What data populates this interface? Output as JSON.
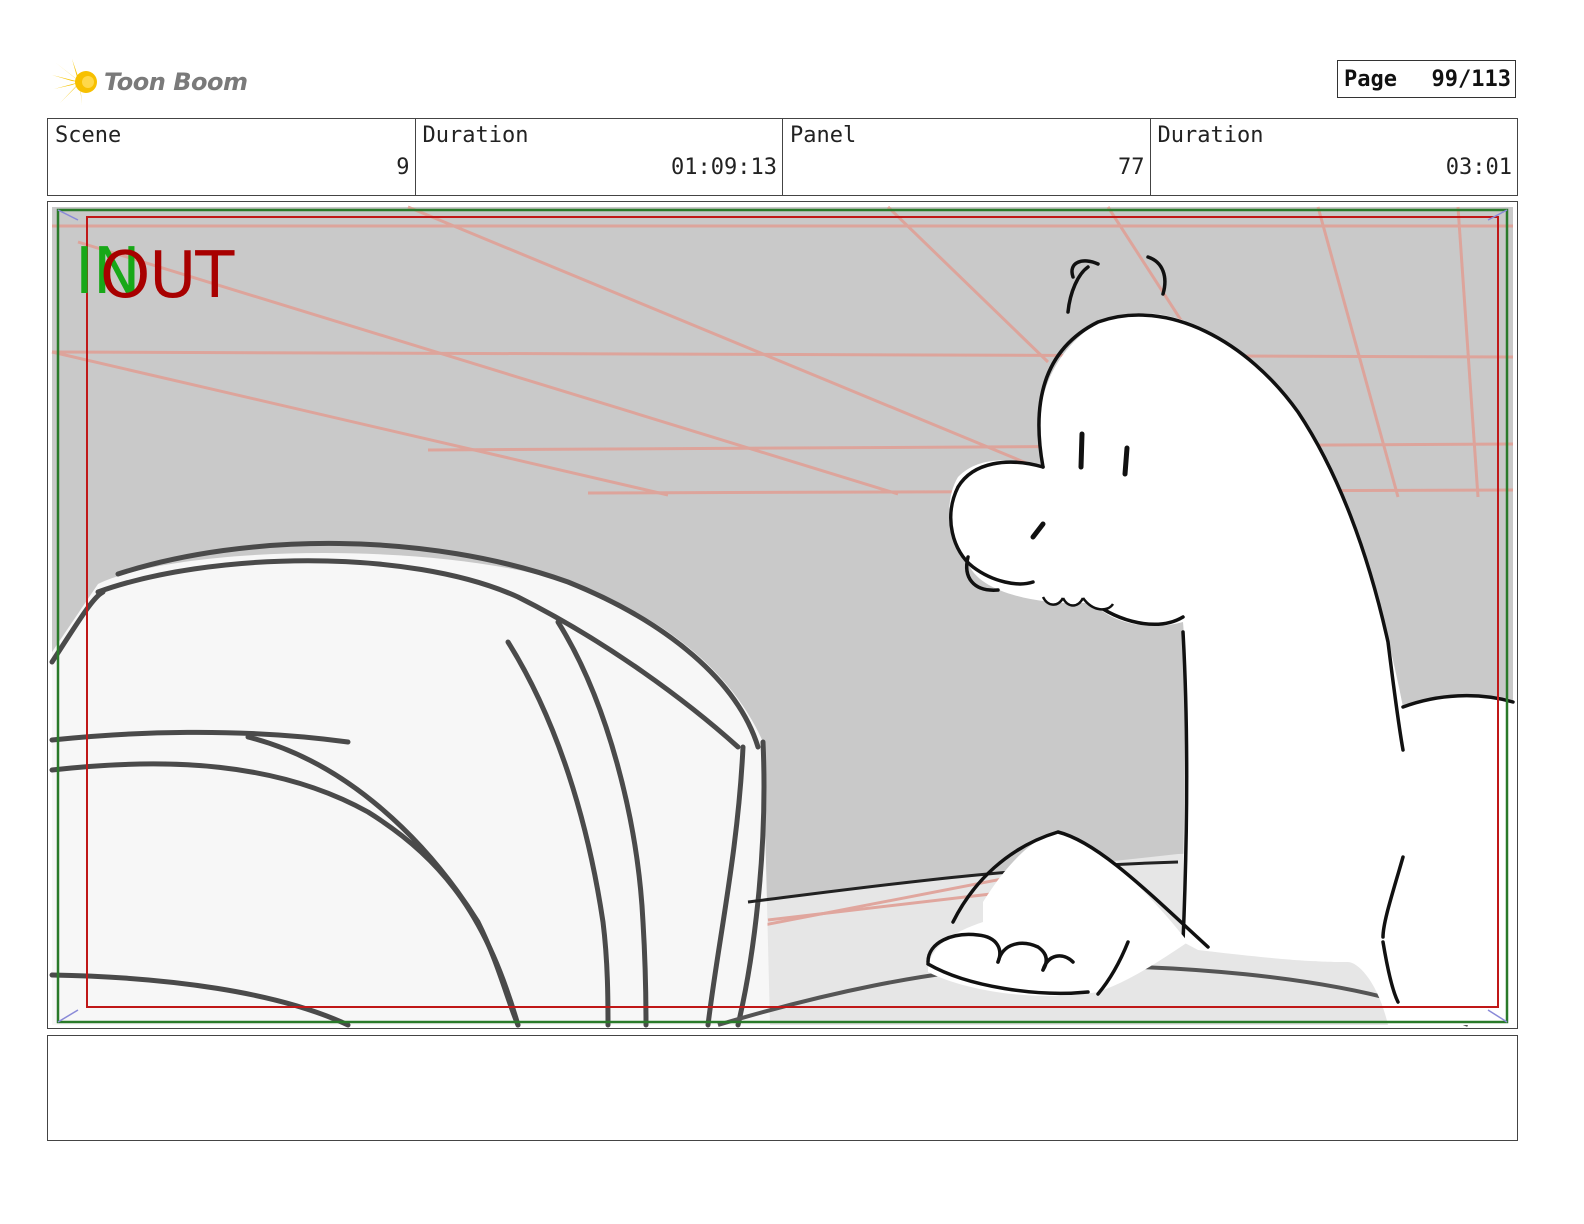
{
  "brand": {
    "name": "Toon Boom"
  },
  "page": {
    "label": "Page",
    "number": "99/113"
  },
  "info": {
    "scene_label": "Scene",
    "scene_value": "9",
    "duration_label": "Duration",
    "duration_value": "01:09:13",
    "panel_label": "Panel",
    "panel_value": "77",
    "panel_duration_label": "Duration",
    "panel_duration_value": "03:01"
  },
  "markers": {
    "in": "IN",
    "out": "OUT"
  },
  "notes": {
    "text": ""
  },
  "colors": {
    "frame_green": "#2a7a2a",
    "frame_red": "#c01818",
    "in_marker": "#18a818",
    "out_marker": "#a80000",
    "sketch_bg": "#c9c9c9",
    "perspective_lines": "#e0a097"
  }
}
